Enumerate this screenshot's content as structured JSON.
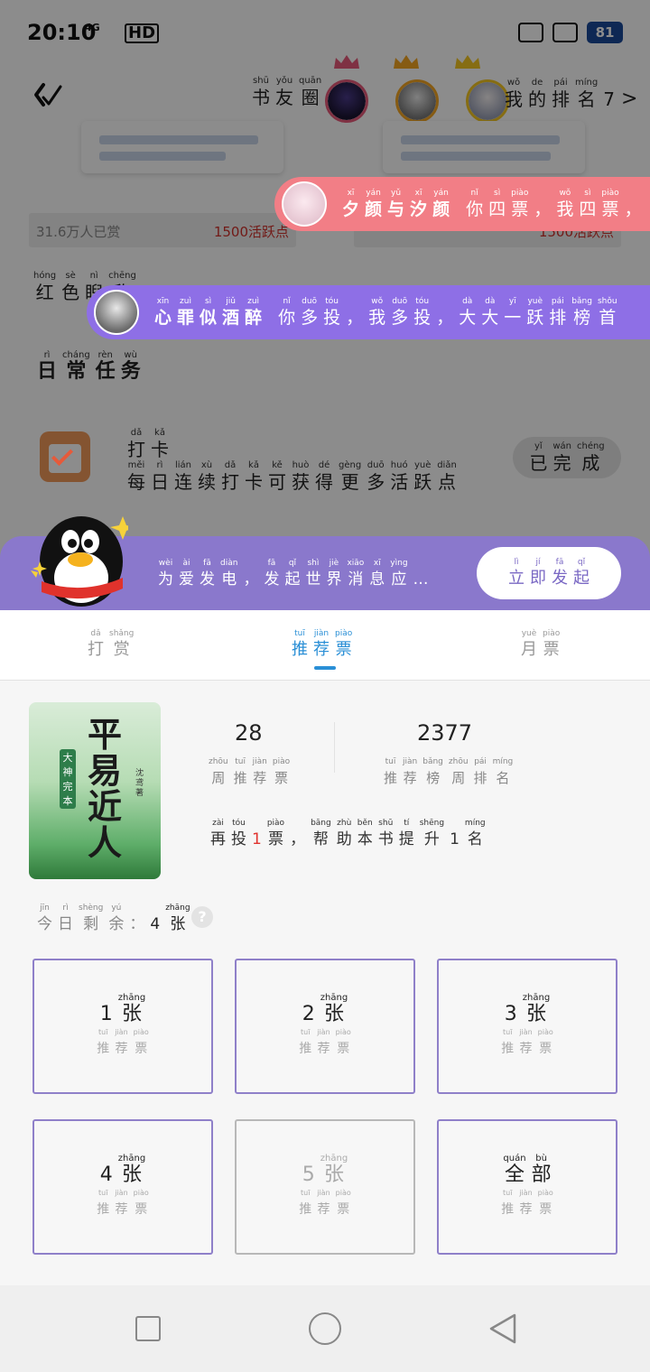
{
  "status_bar": {
    "time": "20:10",
    "network": "4G",
    "hd": "HD",
    "battery": "81"
  },
  "header": {
    "circle_title": [
      {
        "py": "shū",
        "hz": "书"
      },
      {
        "py": "yǒu",
        "hz": "友"
      },
      {
        "py": "quān",
        "hz": "圈"
      }
    ],
    "my_rank": [
      {
        "py": "wǒ",
        "hz": "我"
      },
      {
        "py": "de",
        "hz": "的"
      },
      {
        "py": "pái",
        "hz": "排"
      },
      {
        "py": "míng",
        "hz": "名"
      },
      {
        "py": "",
        "hz": "7"
      }
    ],
    "rank_arrow": ">"
  },
  "background_page": {
    "stat_left": {
      "label": "31.6万人已赏",
      "value": "1500活跃点"
    },
    "stat_right": {
      "label": "",
      "value": "1500活跃点"
    },
    "label_left": [
      {
        "py": "hóng",
        "hz": "红"
      },
      {
        "py": "sè",
        "hz": "色"
      },
      {
        "py": "nì",
        "hz": "睨"
      },
      {
        "py": "chēng",
        "hz": "称"
      }
    ],
    "daily_title": [
      {
        "py": "rì",
        "hz": "日"
      },
      {
        "py": "cháng",
        "hz": "常"
      },
      {
        "py": "rèn",
        "hz": "任"
      },
      {
        "py": "wù",
        "hz": "务"
      }
    ],
    "task_name": [
      {
        "py": "dǎ",
        "hz": "打"
      },
      {
        "py": "kǎ",
        "hz": "卡"
      }
    ],
    "task_desc": [
      {
        "py": "měi",
        "hz": "每"
      },
      {
        "py": "rì",
        "hz": "日"
      },
      {
        "py": "lián",
        "hz": "连"
      },
      {
        "py": "xù",
        "hz": "续"
      },
      {
        "py": "dǎ",
        "hz": "打"
      },
      {
        "py": "kǎ",
        "hz": "卡"
      },
      {
        "py": "kě",
        "hz": "可"
      },
      {
        "py": "huò",
        "hz": "获"
      },
      {
        "py": "dé",
        "hz": "得"
      },
      {
        "py": "gèng",
        "hz": "更"
      },
      {
        "py": "duō",
        "hz": "多"
      },
      {
        "py": "huó",
        "hz": "活"
      },
      {
        "py": "yuè",
        "hz": "跃"
      },
      {
        "py": "diǎn",
        "hz": "点"
      }
    ],
    "task_button": [
      {
        "py": "yǐ",
        "hz": "已"
      },
      {
        "py": "wán",
        "hz": "完"
      },
      {
        "py": "chéng",
        "hz": "成"
      }
    ]
  },
  "danmaku": [
    {
      "name": [
        {
          "py": "xī",
          "hz": "夕"
        },
        {
          "py": "yán",
          "hz": "颜"
        },
        {
          "py": "yǔ",
          "hz": "与"
        },
        {
          "py": "xī",
          "hz": "汐"
        },
        {
          "py": "yán",
          "hz": "颜"
        }
      ],
      "text": [
        {
          "py": "nǐ",
          "hz": "你"
        },
        {
          "py": "sì",
          "hz": "四"
        },
        {
          "py": "piào",
          "hz": "票"
        },
        {
          "py": "",
          "hz": "，"
        },
        {
          "py": "wǒ",
          "hz": "我"
        },
        {
          "py": "sì",
          "hz": "四"
        },
        {
          "py": "piào",
          "hz": "票"
        },
        {
          "py": "",
          "hz": "，"
        }
      ]
    },
    {
      "name": [
        {
          "py": "xīn",
          "hz": "心"
        },
        {
          "py": "zuì",
          "hz": "罪"
        },
        {
          "py": "sì",
          "hz": "似"
        },
        {
          "py": "jiǔ",
          "hz": "酒"
        },
        {
          "py": "zuì",
          "hz": "醉"
        }
      ],
      "text": [
        {
          "py": "nǐ",
          "hz": "你"
        },
        {
          "py": "duō",
          "hz": "多"
        },
        {
          "py": "tóu",
          "hz": "投"
        },
        {
          "py": "",
          "hz": "，"
        },
        {
          "py": "wǒ",
          "hz": "我"
        },
        {
          "py": "duō",
          "hz": "多"
        },
        {
          "py": "tóu",
          "hz": "投"
        },
        {
          "py": "",
          "hz": "，"
        },
        {
          "py": "dà",
          "hz": "大"
        },
        {
          "py": "dà",
          "hz": "大"
        },
        {
          "py": "yī",
          "hz": "一"
        },
        {
          "py": "yuè",
          "hz": "跃"
        },
        {
          "py": "pái",
          "hz": "排"
        },
        {
          "py": "bǎng",
          "hz": "榜"
        },
        {
          "py": "shǒu",
          "hz": "首"
        }
      ]
    }
  ],
  "promo": {
    "text": [
      {
        "py": "wèi",
        "hz": "为"
      },
      {
        "py": "ài",
        "hz": "爱"
      },
      {
        "py": "fā",
        "hz": "发"
      },
      {
        "py": "diàn",
        "hz": "电"
      },
      {
        "py": "",
        "hz": "，"
      },
      {
        "py": "fā",
        "hz": "发"
      },
      {
        "py": "qǐ",
        "hz": "起"
      },
      {
        "py": "shì",
        "hz": "世"
      },
      {
        "py": "jiè",
        "hz": "界"
      },
      {
        "py": "xiāo",
        "hz": "消"
      },
      {
        "py": "xī",
        "hz": "息"
      },
      {
        "py": "yìng",
        "hz": "应"
      },
      {
        "py": "",
        "hz": "…"
      }
    ],
    "button": [
      {
        "py": "lì",
        "hz": "立"
      },
      {
        "py": "jí",
        "hz": "即"
      },
      {
        "py": "fā",
        "hz": "发"
      },
      {
        "py": "qǐ",
        "hz": "起"
      }
    ]
  },
  "tabs": [
    {
      "chars": [
        {
          "py": "dǎ",
          "hz": "打"
        },
        {
          "py": "shǎng",
          "hz": "赏"
        }
      ],
      "active": false
    },
    {
      "chars": [
        {
          "py": "tuī",
          "hz": "推"
        },
        {
          "py": "jiàn",
          "hz": "荐"
        },
        {
          "py": "piào",
          "hz": "票"
        }
      ],
      "active": true
    },
    {
      "chars": [
        {
          "py": "yuè",
          "hz": "月"
        },
        {
          "py": "piào",
          "hz": "票"
        }
      ],
      "active": false
    }
  ],
  "book": {
    "cover_title": "平易近人",
    "cover_badge": "大神完本",
    "cover_author": "沈鸢著"
  },
  "stats": {
    "weekly_votes": "28",
    "weekly_votes_label": [
      {
        "py": "zhōu",
        "hz": "周"
      },
      {
        "py": "tuī",
        "hz": "推"
      },
      {
        "py": "jiàn",
        "hz": "荐"
      },
      {
        "py": "piào",
        "hz": "票"
      }
    ],
    "weekly_rank": "2377",
    "weekly_rank_label": [
      {
        "py": "tuī",
        "hz": "推"
      },
      {
        "py": "jiàn",
        "hz": "荐"
      },
      {
        "py": "bǎng",
        "hz": "榜"
      },
      {
        "py": "zhōu",
        "hz": "周"
      },
      {
        "py": "pái",
        "hz": "排"
      },
      {
        "py": "míng",
        "hz": "名"
      }
    ],
    "hint": [
      {
        "py": "zài",
        "hz": "再"
      },
      {
        "py": "tóu",
        "hz": "投"
      },
      {
        "py": "",
        "hz": "1",
        "red": true
      },
      {
        "py": "piào",
        "hz": "票"
      },
      {
        "py": "",
        "hz": "，"
      },
      {
        "py": "bāng",
        "hz": "帮"
      },
      {
        "py": "zhù",
        "hz": "助"
      },
      {
        "py": "běn",
        "hz": "本"
      },
      {
        "py": "shū",
        "hz": "书"
      },
      {
        "py": "tí",
        "hz": "提"
      },
      {
        "py": "shēng",
        "hz": "升"
      },
      {
        "py": "",
        "hz": "1"
      },
      {
        "py": "míng",
        "hz": "名"
      }
    ]
  },
  "remaining": {
    "label": [
      {
        "py": "jīn",
        "hz": "今"
      },
      {
        "py": "rì",
        "hz": "日"
      },
      {
        "py": "shèng",
        "hz": "剩"
      },
      {
        "py": "yú",
        "hz": "余"
      },
      {
        "py": "",
        "hz": "："
      }
    ],
    "value": [
      {
        "py": "",
        "hz": "4"
      },
      {
        "py": "zhāng",
        "hz": "张"
      }
    ],
    "help": "?"
  },
  "options": [
    {
      "main": [
        {
          "py": "",
          "hz": "1"
        },
        {
          "py": "zhāng",
          "hz": "张"
        }
      ],
      "disabled": false
    },
    {
      "main": [
        {
          "py": "",
          "hz": "2"
        },
        {
          "py": "zhāng",
          "hz": "张"
        }
      ],
      "disabled": false
    },
    {
      "main": [
        {
          "py": "",
          "hz": "3"
        },
        {
          "py": "zhāng",
          "hz": "张"
        }
      ],
      "disabled": false
    },
    {
      "main": [
        {
          "py": "",
          "hz": "4"
        },
        {
          "py": "zhāng",
          "hz": "张"
        }
      ],
      "disabled": false
    },
    {
      "main": [
        {
          "py": "",
          "hz": "5"
        },
        {
          "py": "zhāng",
          "hz": "张"
        }
      ],
      "disabled": true
    },
    {
      "main": [
        {
          "py": "quán",
          "hz": "全"
        },
        {
          "py": "bù",
          "hz": "部"
        }
      ],
      "disabled": false
    }
  ],
  "option_sub": [
    {
      "py": "tuī",
      "hz": "推"
    },
    {
      "py": "jiàn",
      "hz": "荐"
    },
    {
      "py": "piào",
      "hz": "票"
    }
  ],
  "colors": {
    "accent": "#2a8fd6",
    "option_border": "#8f80c9",
    "promo_bg": "#8a78cc",
    "danmaku_pink": "#f27e86",
    "danmaku_purple": "#8e6fe6",
    "highlight_red": "#e0332e"
  }
}
